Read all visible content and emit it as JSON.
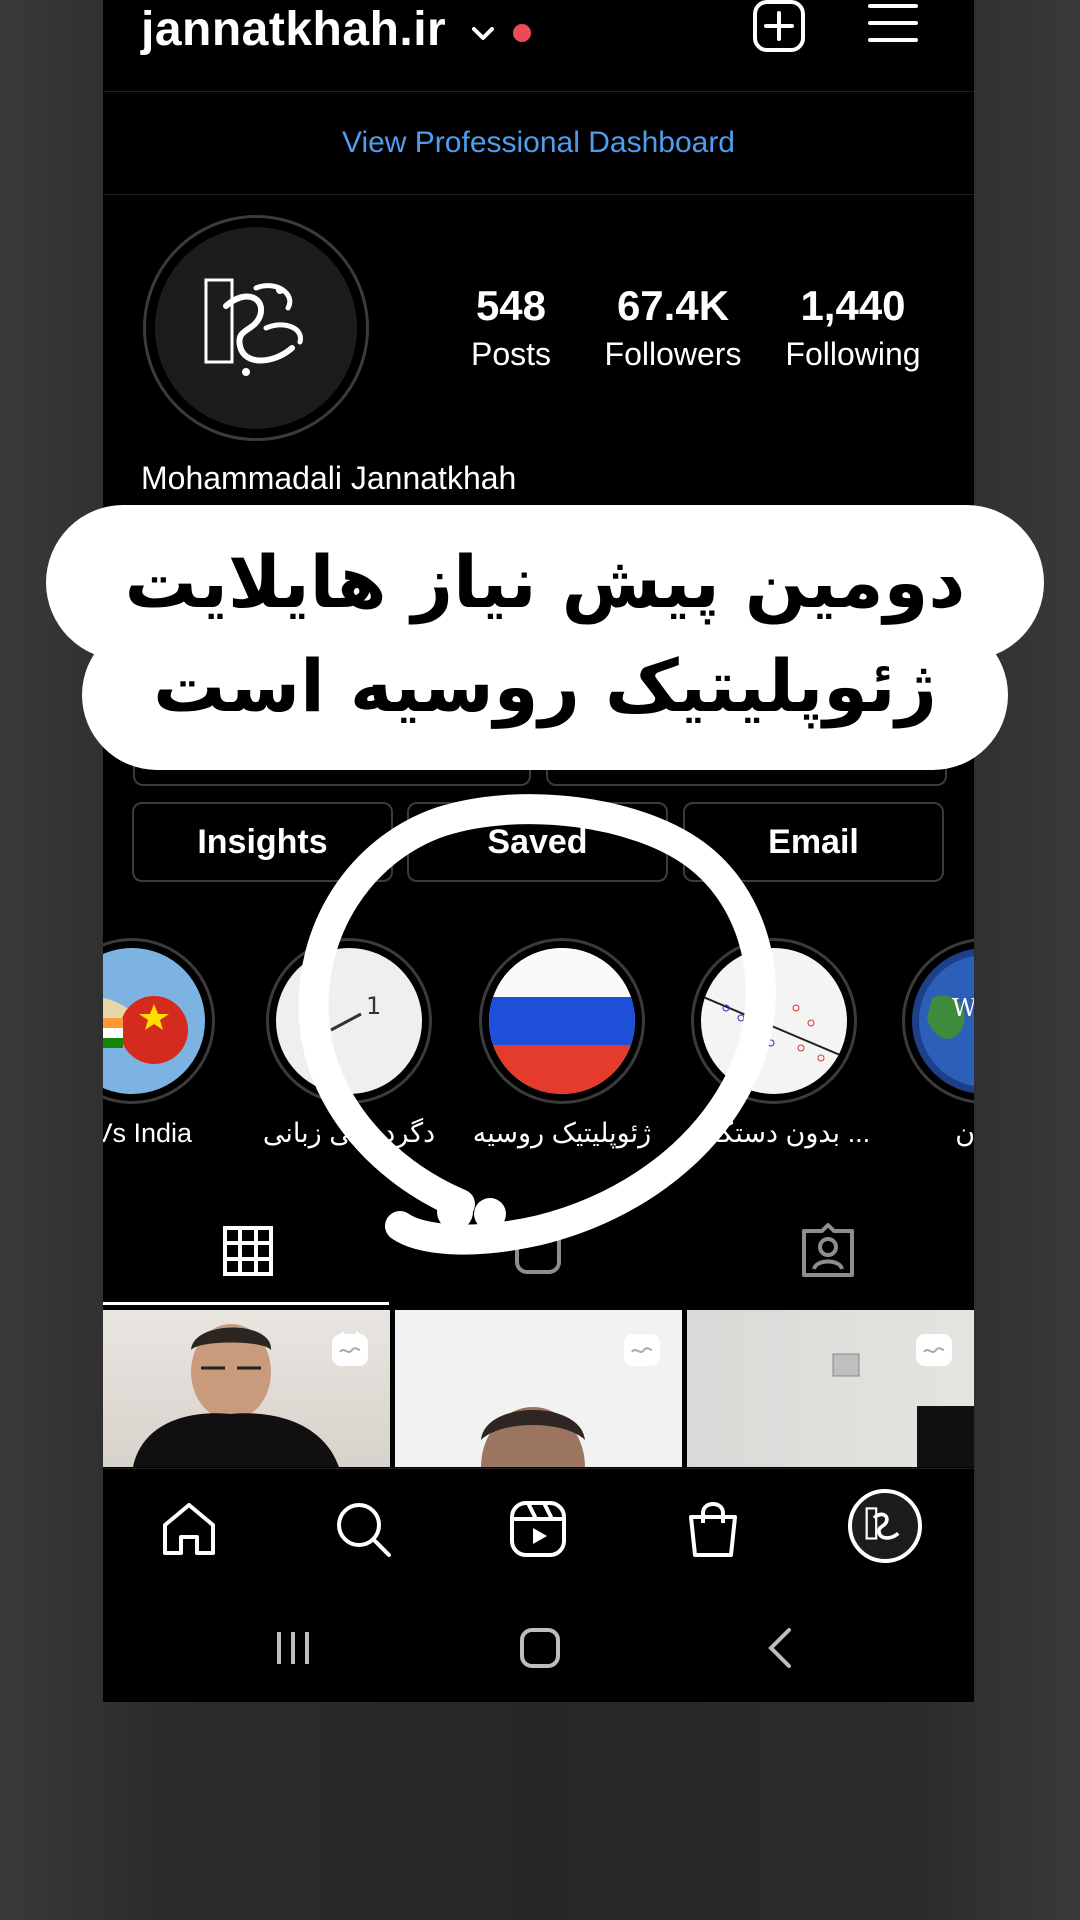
{
  "header": {
    "username": "jannatkhah.ir",
    "chevron_icon": "chevron-down-icon",
    "notification_dot_color": "#ed4956",
    "new_post_icon": "plus-square-icon",
    "menu_icon": "hamburger-menu-icon"
  },
  "dashboard_link": "View Professional Dashboard",
  "profile": {
    "full_name": "Mohammadali Jannatkhah",
    "stats": [
      {
        "value": "548",
        "label": "Posts"
      },
      {
        "value": "67.4K",
        "label": "Followers"
      },
      {
        "value": "1,440",
        "label": "Following"
      }
    ]
  },
  "buttons": {
    "insights": "Insights",
    "saved": "Saved",
    "email": "Email"
  },
  "highlights": [
    {
      "label": "a Vs India"
    },
    {
      "label": "دگردیسی زبانی",
      "badge": "1"
    },
    {
      "label": "ژئوپلیتیک روسیه"
    },
    {
      "label": "بدون دستکاری ..."
    },
    {
      "label": "آلمان",
      "image_text": "We Geo"
    }
  ],
  "tabs": [
    "grid-icon",
    "reels-icon",
    "tagged-icon"
  ],
  "bottom_nav": [
    "home-icon",
    "search-icon",
    "reels-icon",
    "shop-icon",
    "profile-avatar"
  ],
  "system_nav": [
    "recents-icon",
    "home-button-icon",
    "back-icon"
  ],
  "overlay": {
    "line1": "دومین پیش نیاز هایلایت",
    "line2": "ژئوپلیتیک روسیه است"
  },
  "colors": {
    "link_blue": "#4f9ded",
    "background": "#000000",
    "overlay_bubble": "#ffffff"
  }
}
